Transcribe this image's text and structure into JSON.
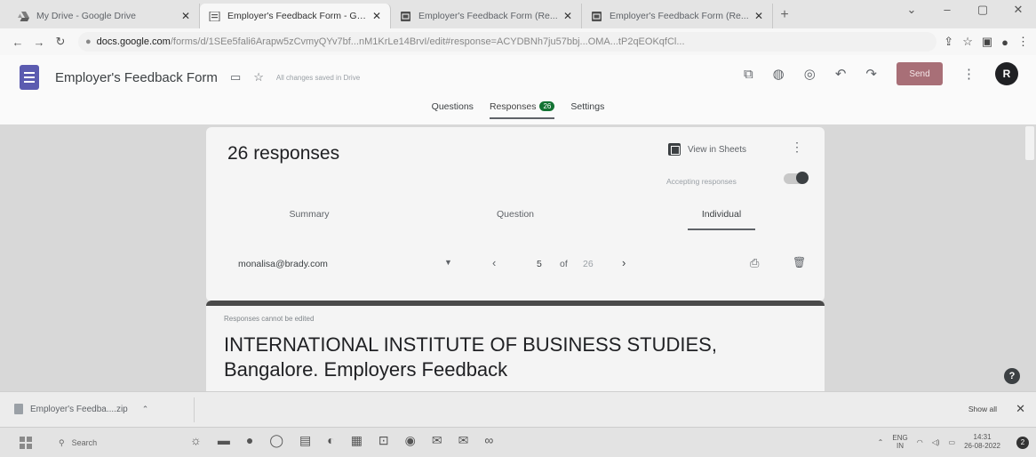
{
  "browser": {
    "tabs": [
      {
        "label": "My Drive - Google Drive",
        "icon": "drive-icon",
        "active": false
      },
      {
        "label": "Employer's Feedback Form - Go...",
        "icon": "forms-icon",
        "active": true
      },
      {
        "label": "Employer's Feedback Form (Re...",
        "icon": "sheets-icon",
        "active": false
      },
      {
        "label": "Employer's Feedback Form (Re...",
        "icon": "sheets-icon",
        "active": false
      }
    ],
    "new_tab": "+",
    "url_domain": "docs.google.com",
    "url_path": "/forms/d/1SEe5fali6Arapw5zCvmyQYv7bf...nM1KrLe14BrvI/edit#response=ACYDBNh7ju57bbj...OMA...tP2qEOKqfCl..."
  },
  "form_header": {
    "title": "Employer's Feedback Form",
    "saved_status": "All changes saved in Drive",
    "send_label": "Send",
    "avatar_letter": "R",
    "accent_color": "#a86f77"
  },
  "form_tabs": {
    "questions": "Questions",
    "responses": "Responses",
    "responses_count": "26",
    "settings": "Settings"
  },
  "summary": {
    "count_label": "26 responses",
    "view_in_sheets": "View in Sheets",
    "accepting": "Accepting responses",
    "subtabs": [
      "Summary",
      "Question",
      "Individual"
    ],
    "email": "monalisa@brady.com",
    "current": "5",
    "of": "of",
    "total": "26"
  },
  "response": {
    "note": "Responses cannot be edited",
    "title": "INTERNATIONAL INSTITUTE OF BUSINESS STUDIES, Bangalore. Employers Feedback"
  },
  "download": {
    "file": "Employer's Feedba....zip",
    "show_all": "Show all"
  },
  "taskbar": {
    "search": "Search",
    "lang_top": "ENG",
    "lang_bottom": "IN",
    "time": "14:31",
    "date": "26-08-2022",
    "notif_count": "2"
  }
}
